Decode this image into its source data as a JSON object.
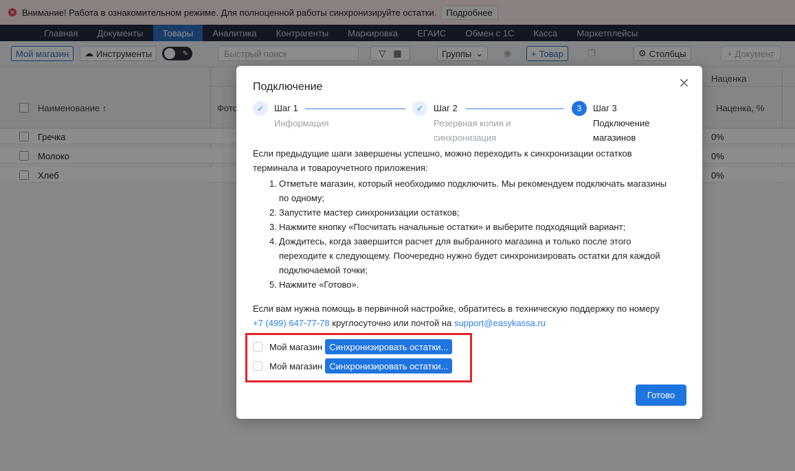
{
  "warning": {
    "icon": "error-circle-icon",
    "text": "Внимание! Работа в ознакомительном режиме. Для полноценной работы синхронизируйте остатки.",
    "link_label": "Подробнее"
  },
  "nav": {
    "items": [
      "Главная",
      "Документы",
      "Товары",
      "Аналитика",
      "Контрагенты",
      "Маркировка",
      "ЕГАИС",
      "Обмен с 1С",
      "Касса",
      "Маркетплейсы"
    ],
    "active": "Товары"
  },
  "toolbar": {
    "store_label": "Мой магазин",
    "tools_label": "Инструменты",
    "search_placeholder": "Быстрый поиск",
    "groups_label": "Группы",
    "add_product_label": "Товар",
    "columns_label": "Столбцы",
    "add_document_label": "Документ"
  },
  "table": {
    "col_name": "Наименование ↑",
    "col_photo": "Фото",
    "col_margin_group": "Наценка",
    "col_margin": "Наценка, %",
    "rows": [
      {
        "name": "Гречка",
        "margin": "0%"
      },
      {
        "name": "Молоко",
        "margin": "0%"
      },
      {
        "name": "Хлеб",
        "margin": "0%"
      }
    ]
  },
  "modal": {
    "title": "Подключение",
    "steps": [
      {
        "num": "✓",
        "title": "Шаг 1",
        "sub1": "Информация",
        "sub2": ""
      },
      {
        "num": "✓",
        "title": "Шаг 2",
        "sub1": "Резервная копия и",
        "sub2": "синхронизация"
      },
      {
        "num": "3",
        "title": "Шаг 3",
        "sub1": "Подключение",
        "sub2": "магазинов"
      }
    ],
    "intro1": "Если предыдущие шаги завершены успешно, можно переходить к синхронизации остатков",
    "intro2": "терминала и товароучетного приложения:",
    "list": [
      {
        "num": "1.",
        "lines": [
          "Отметьте магазин, который необходимо подключить. Мы рекомендуем подключать магазины",
          "по одному;"
        ]
      },
      {
        "num": "2.",
        "lines": [
          "Запустите мастер синхронизации остатков;"
        ]
      },
      {
        "num": "3.",
        "lines": [
          "Нажмите кнопку «Посчитать начальные остатки» и выберите подходящий вариант;"
        ]
      },
      {
        "num": "4.",
        "lines": [
          "Дождитесь, когда завершится расчет для выбранного магазина и только после этого",
          "переходите к следующему. Поочередно нужно будет синхронизировать остатки для каждой",
          "подключаемой точки;"
        ]
      },
      {
        "num": "5.",
        "lines": [
          "Нажмите «Готово»."
        ]
      }
    ],
    "help1": "Если вам нужна помощь в первичной настройке, обратитесь в техническую поддержку по номеру",
    "phone": "+7 (499) 647-77-78",
    "help2": " круглосуточно или почтой на ",
    "email": "support@easykassa.ru",
    "stores": [
      {
        "label": "Мой магазин",
        "button": "Синхронизировать остатки..."
      },
      {
        "label": "Мой магазин",
        "button": "Синхронизировать остатки..."
      }
    ],
    "done_label": "Готово",
    "close_icon": "close-icon"
  },
  "colors": {
    "accent": "#1f75e0",
    "nav_bg": "#212a3e",
    "highlight": "#e5232b"
  }
}
